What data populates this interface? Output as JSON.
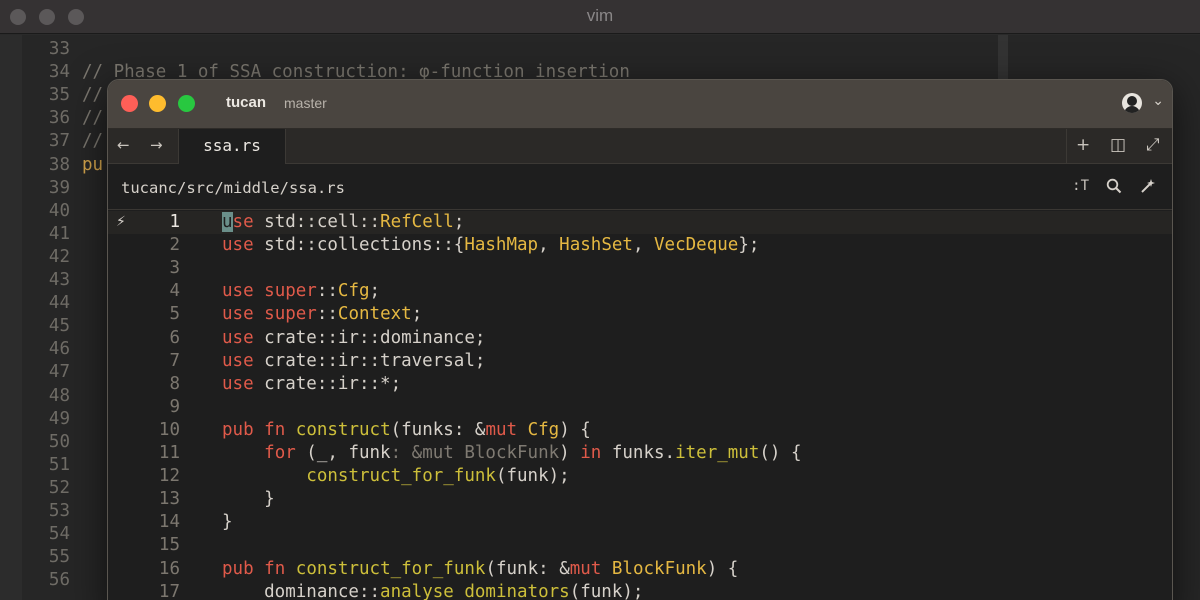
{
  "vim": {
    "title": "vim",
    "lines": [
      {
        "n": "33",
        "text": "",
        "kind": "blank"
      },
      {
        "n": "34",
        "text": "// Phase 1 of SSA construction: φ-function insertion",
        "kind": "comment"
      },
      {
        "n": "35",
        "text": "//",
        "kind": "comment"
      },
      {
        "n": "36",
        "text": "//",
        "kind": "comment"
      },
      {
        "n": "37",
        "text": "//",
        "kind": "comment"
      },
      {
        "n": "38",
        "text": "pu",
        "kind": "code"
      },
      {
        "n": "39",
        "text": "",
        "kind": "blank"
      },
      {
        "n": "40",
        "text": "",
        "kind": "blank"
      },
      {
        "n": "41",
        "text": "",
        "kind": "blank"
      },
      {
        "n": "42",
        "text": "",
        "kind": "blank"
      },
      {
        "n": "43",
        "text": "",
        "kind": "blank"
      },
      {
        "n": "44",
        "text": "",
        "kind": "blank"
      },
      {
        "n": "45",
        "text": "",
        "kind": "blank"
      },
      {
        "n": "46",
        "text": "",
        "kind": "blank"
      },
      {
        "n": "47",
        "text": "",
        "kind": "blank"
      },
      {
        "n": "48",
        "text": "",
        "kind": "blank"
      },
      {
        "n": "49",
        "text": "",
        "kind": "blank"
      },
      {
        "n": "50",
        "text": "",
        "kind": "blank"
      },
      {
        "n": "51",
        "text": "",
        "kind": "blank"
      },
      {
        "n": "52",
        "text": "",
        "kind": "blank"
      },
      {
        "n": "53",
        "text": "",
        "kind": "blank"
      },
      {
        "n": "54",
        "text": "",
        "kind": "blank"
      },
      {
        "n": "55",
        "text": "",
        "kind": "blank"
      },
      {
        "n": "56",
        "text": "",
        "kind": "blank"
      }
    ]
  },
  "terminal": {
    "name": "tucan",
    "branch": "master",
    "avatar_icon": "user-avatar-icon",
    "chevron": "⌄",
    "nav": {
      "back": "←",
      "forward": "→"
    },
    "tab_label": "ssa.rs",
    "tab_actions": {
      "new": "+",
      "split": "◫",
      "expand": "⤢"
    },
    "path": "tucanc/src/middle/ssa.rs",
    "path_tools": {
      "type_label": ":T",
      "search_icon": "search-icon",
      "magic_icon": "magic-wand-icon"
    },
    "gutter_icon": "⚡",
    "code_lines": [
      {
        "n": "1",
        "current": true,
        "segs": [
          [
            "cur",
            "u"
          ],
          [
            "k",
            "se"
          ],
          [
            "p",
            " std::cell::"
          ],
          [
            "t",
            "RefCell"
          ],
          [
            "p",
            ";"
          ]
        ]
      },
      {
        "n": "2",
        "segs": [
          [
            "k",
            "use"
          ],
          [
            "p",
            " std::collections::{"
          ],
          [
            "t",
            "HashMap"
          ],
          [
            "p",
            ", "
          ],
          [
            "t",
            "HashSet"
          ],
          [
            "p",
            ", "
          ],
          [
            "t",
            "VecDeque"
          ],
          [
            "p",
            "};"
          ]
        ]
      },
      {
        "n": "3",
        "segs": []
      },
      {
        "n": "4",
        "segs": [
          [
            "k",
            "use"
          ],
          [
            "p",
            " "
          ],
          [
            "k",
            "super"
          ],
          [
            "p",
            "::"
          ],
          [
            "t",
            "Cfg"
          ],
          [
            "p",
            ";"
          ]
        ]
      },
      {
        "n": "5",
        "segs": [
          [
            "k",
            "use"
          ],
          [
            "p",
            " "
          ],
          [
            "k",
            "super"
          ],
          [
            "p",
            "::"
          ],
          [
            "t",
            "Context"
          ],
          [
            "p",
            ";"
          ]
        ]
      },
      {
        "n": "6",
        "segs": [
          [
            "k",
            "use"
          ],
          [
            "p",
            " crate::ir::dominance;"
          ]
        ]
      },
      {
        "n": "7",
        "segs": [
          [
            "k",
            "use"
          ],
          [
            "p",
            " crate::ir::traversal;"
          ]
        ]
      },
      {
        "n": "8",
        "segs": [
          [
            "k",
            "use"
          ],
          [
            "p",
            " crate::ir::*;"
          ]
        ]
      },
      {
        "n": "9",
        "segs": []
      },
      {
        "n": "10",
        "segs": [
          [
            "k",
            "pub"
          ],
          [
            "p",
            " "
          ],
          [
            "k",
            "fn"
          ],
          [
            "p",
            " "
          ],
          [
            "f",
            "construct"
          ],
          [
            "p",
            "(funks: &"
          ],
          [
            "k",
            "mut"
          ],
          [
            "p",
            " "
          ],
          [
            "t",
            "Cfg"
          ],
          [
            "p",
            ") {"
          ]
        ]
      },
      {
        "n": "11",
        "segs": [
          [
            "p",
            "    "
          ],
          [
            "k",
            "for"
          ],
          [
            "p",
            " (_, funk"
          ],
          [
            "dim",
            ": &mut BlockFunk"
          ],
          [
            "p",
            ") "
          ],
          [
            "k",
            "in"
          ],
          [
            "p",
            " funks."
          ],
          [
            "f",
            "iter_mut"
          ],
          [
            "p",
            "() {"
          ]
        ]
      },
      {
        "n": "12",
        "segs": [
          [
            "p",
            "        "
          ],
          [
            "f",
            "construct_for_funk"
          ],
          [
            "p",
            "(funk);"
          ]
        ]
      },
      {
        "n": "13",
        "segs": [
          [
            "p",
            "    }"
          ]
        ]
      },
      {
        "n": "14",
        "segs": [
          [
            "p",
            "}"
          ]
        ]
      },
      {
        "n": "15",
        "segs": []
      },
      {
        "n": "16",
        "segs": [
          [
            "k",
            "pub"
          ],
          [
            "p",
            " "
          ],
          [
            "k",
            "fn"
          ],
          [
            "p",
            " "
          ],
          [
            "f",
            "construct_for_funk"
          ],
          [
            "p",
            "(funk: &"
          ],
          [
            "k",
            "mut"
          ],
          [
            "p",
            " "
          ],
          [
            "t",
            "BlockFunk"
          ],
          [
            "p",
            ") {"
          ]
        ]
      },
      {
        "n": "17",
        "segs": [
          [
            "p",
            "    dominance::"
          ],
          [
            "f",
            "analyse_dominators"
          ],
          [
            "p",
            "(funk);"
          ]
        ]
      }
    ]
  }
}
